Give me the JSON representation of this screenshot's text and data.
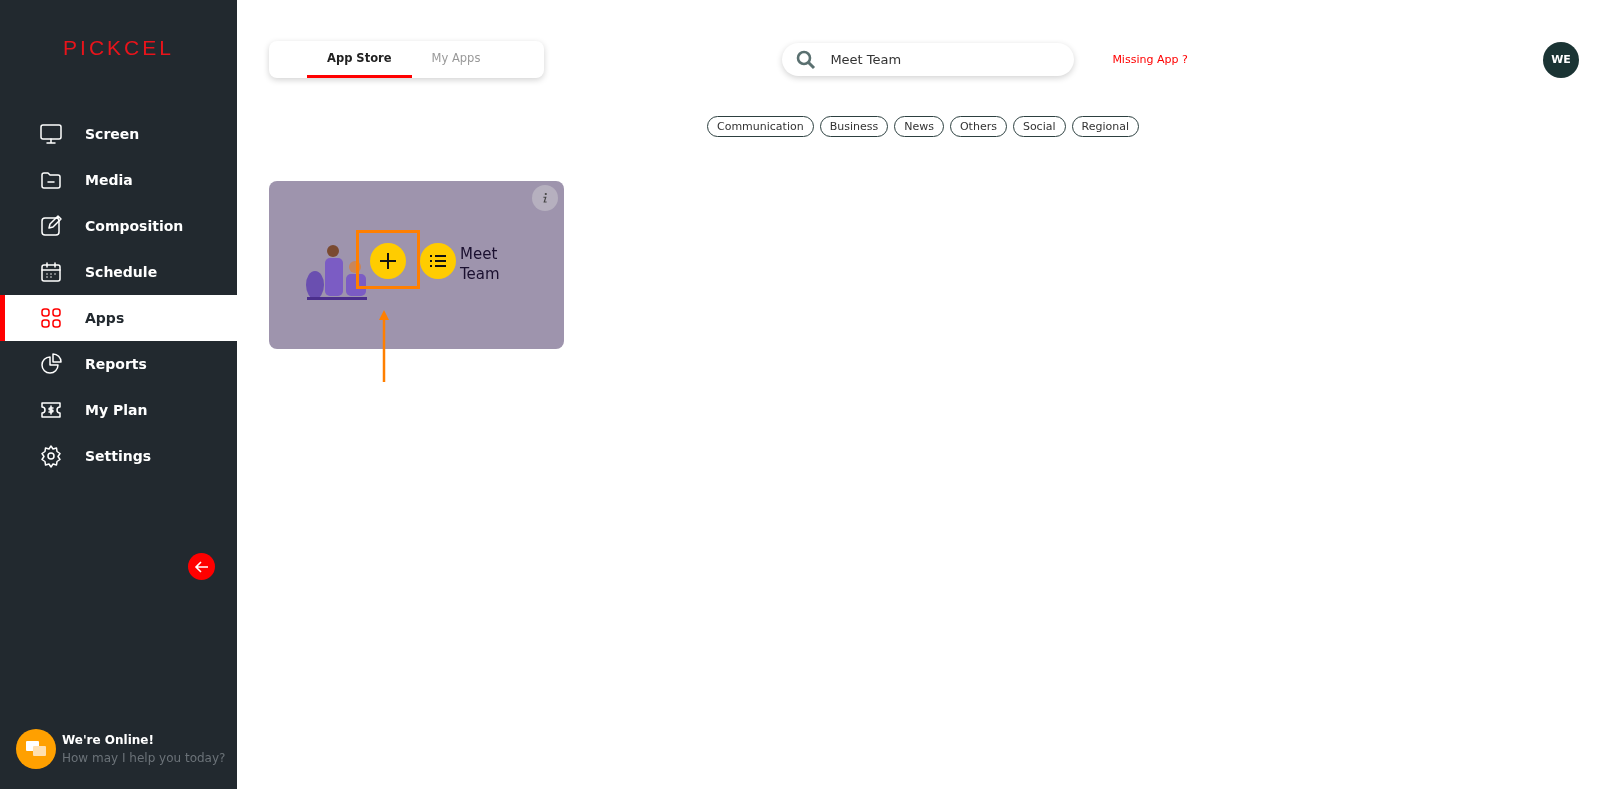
{
  "sidebar": {
    "logo": "PICKCEL",
    "items": [
      {
        "label": "Screen",
        "selected": false
      },
      {
        "label": "Media",
        "selected": false
      },
      {
        "label": "Composition",
        "selected": false
      },
      {
        "label": "Schedule",
        "selected": false
      },
      {
        "label": "Apps",
        "selected": true
      },
      {
        "label": "Reports",
        "selected": false
      },
      {
        "label": "My Plan",
        "selected": false
      },
      {
        "label": "Settings",
        "selected": false
      }
    ],
    "chat": {
      "title": "We're Online!",
      "subtitle": "How may I help you today?"
    }
  },
  "tabs": [
    {
      "label": "App Store",
      "selected": true
    },
    {
      "label": "My Apps",
      "selected": false
    }
  ],
  "search": {
    "value": "Meet Team"
  },
  "missing_app_link": "Missing App ?",
  "avatar": "WE",
  "categories": [
    "Communication",
    "Business",
    "News",
    "Others",
    "Social",
    "Regional"
  ],
  "apps": [
    {
      "thumbnail_text": "Meet Team",
      "highlighted": true
    }
  ]
}
